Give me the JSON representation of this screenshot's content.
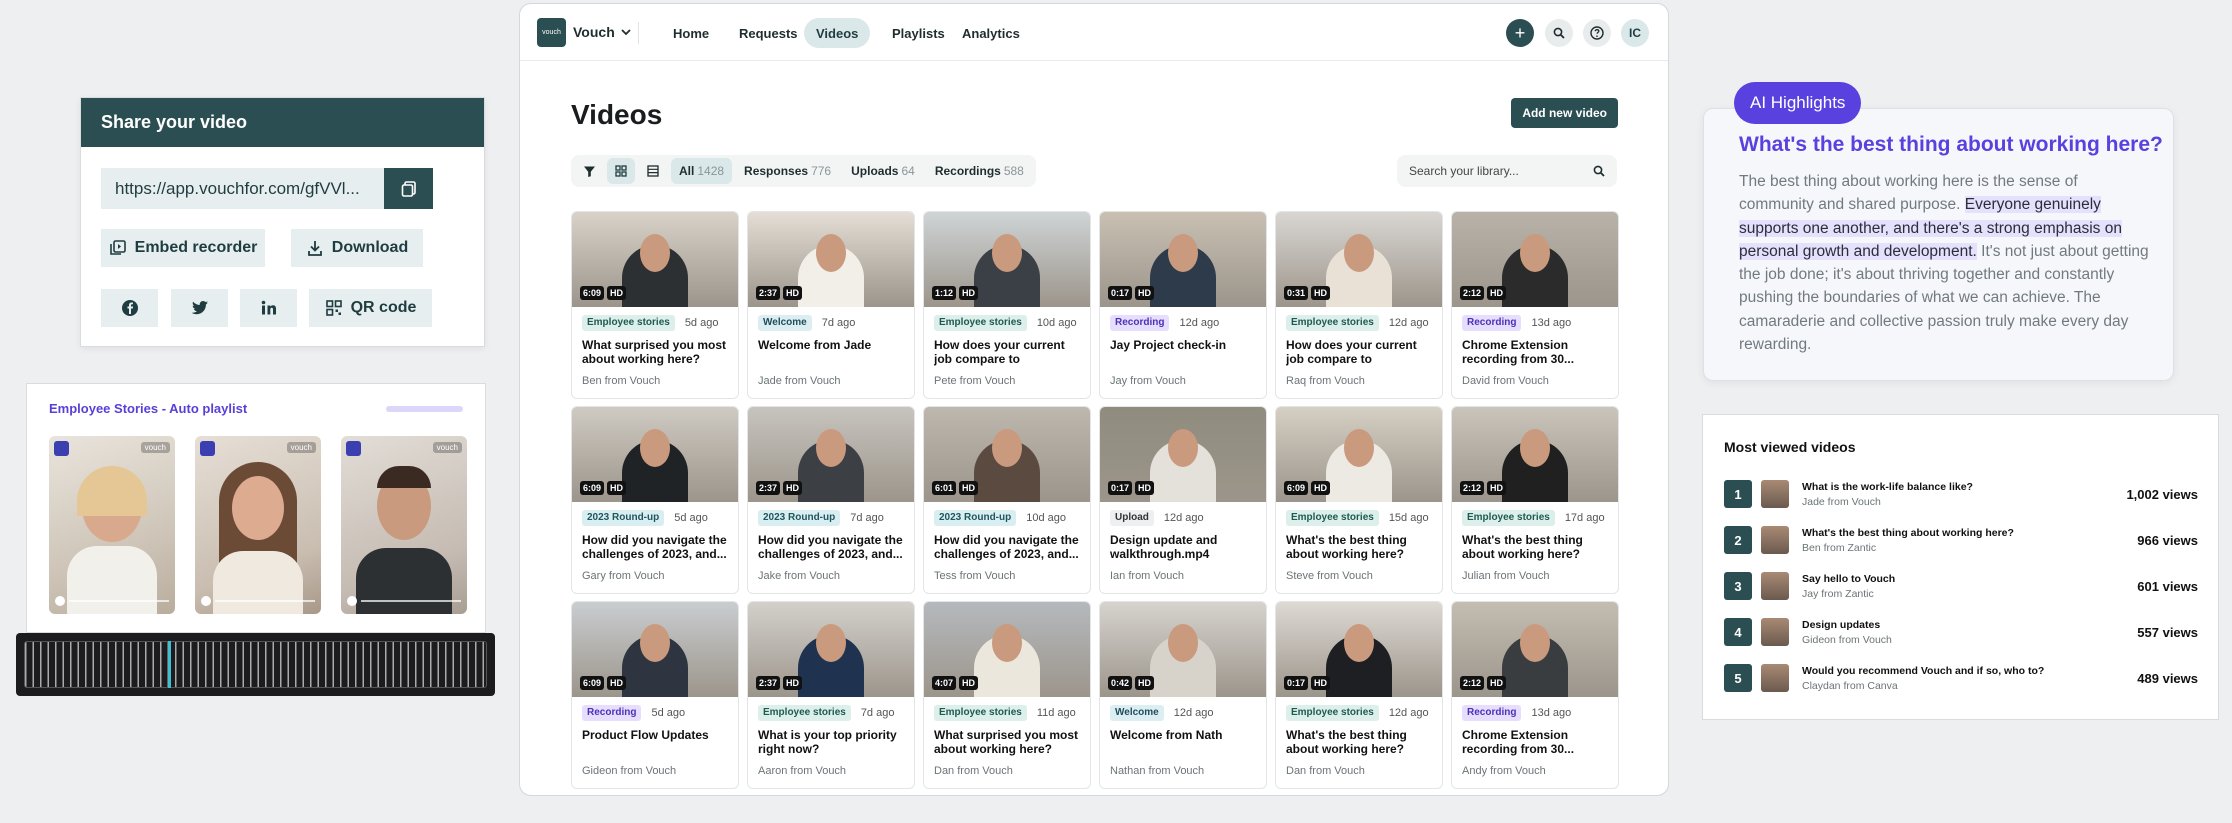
{
  "share": {
    "title": "Share your video",
    "url": "https://app.vouchfor.com/gfVVl...",
    "embed_label": "Embed recorder",
    "download_label": "Download",
    "qr_label": "QR code"
  },
  "playlist": {
    "title": "Employee Stories - Auto playlist",
    "badge": "vouch"
  },
  "app": {
    "logo": "vouch",
    "brand": "Vouch",
    "nav": [
      "Home",
      "Requests",
      "Videos",
      "Playlists",
      "Analytics"
    ],
    "avatar": "IC",
    "page_title": "Videos",
    "add_button": "Add new video",
    "filters": [
      {
        "label": "All",
        "count": "1428"
      },
      {
        "label": "Responses",
        "count": "776"
      },
      {
        "label": "Uploads",
        "count": "64"
      },
      {
        "label": "Recordings",
        "count": "588"
      }
    ],
    "search_placeholder": "Search your library...",
    "videos": [
      {
        "dur": "6:09",
        "q": "HD",
        "tag": "Employee stories",
        "ago": "5d ago",
        "title": "What surprised you most about working here?",
        "author": "Ben from Vouch"
      },
      {
        "dur": "2:37",
        "q": "HD",
        "tag": "Welcome",
        "ago": "7d ago",
        "title": "Welcome from Jade",
        "author": "Jade from Vouch"
      },
      {
        "dur": "1:12",
        "q": "HD",
        "tag": "Employee stories",
        "ago": "10d ago",
        "title": "How does your current job compare to previous...",
        "author": "Pete from Vouch"
      },
      {
        "dur": "0:17",
        "q": "HD",
        "tag": "Recording",
        "ago": "12d ago",
        "title": "Jay  Project check-in",
        "author": "Jay from Vouch"
      },
      {
        "dur": "0:31",
        "q": "HD",
        "tag": "Employee stories",
        "ago": "12d ago",
        "title": "How does your current job compare to previous...",
        "author": "Raq from Vouch"
      },
      {
        "dur": "2:12",
        "q": "HD",
        "tag": "Recording",
        "ago": "13d ago",
        "title": "Chrome Extension recording from 30...",
        "author": "David from Vouch"
      },
      {
        "dur": "6:09",
        "q": "HD",
        "tag": "2023 Round-up",
        "ago": "5d ago",
        "title": "How did you navigate the challenges of 2023, and...",
        "author": "Gary from Vouch"
      },
      {
        "dur": "2:37",
        "q": "HD",
        "tag": "2023 Round-up",
        "ago": "7d ago",
        "title": "How did you navigate the challenges of 2023, and...",
        "author": "Jake from Vouch"
      },
      {
        "dur": "6:01",
        "q": "HD",
        "tag": "2023 Round-up",
        "ago": "10d ago",
        "title": "How did you navigate the challenges of 2023, and...",
        "author": "Tess from Vouch"
      },
      {
        "dur": "0:17",
        "q": "HD",
        "tag": "Upload",
        "ago": "12d ago",
        "title": "Design update and walkthrough.mp4",
        "author": "Ian from Vouch"
      },
      {
        "dur": "6:09",
        "q": "HD",
        "tag": "Employee stories",
        "ago": "15d ago",
        "title": "What's the best thing about working here?",
        "author": "Steve from Vouch"
      },
      {
        "dur": "2:12",
        "q": "HD",
        "tag": "Employee stories",
        "ago": "17d ago",
        "title": "What's the best thing about working here?",
        "author": "Julian from Vouch"
      },
      {
        "dur": "6:09",
        "q": "HD",
        "tag": "Recording",
        "ago": "5d ago",
        "title": "Product Flow Updates",
        "author": "Gideon from Vouch"
      },
      {
        "dur": "2:37",
        "q": "HD",
        "tag": "Employee stories",
        "ago": "7d ago",
        "title": "What is your top priority right now?",
        "author": "Aaron from Vouch"
      },
      {
        "dur": "4:07",
        "q": "HD",
        "tag": "Employee stories",
        "ago": "11d ago",
        "title": "What surprised you most about working here?",
        "author": "Dan from Vouch"
      },
      {
        "dur": "0:42",
        "q": "HD",
        "tag": "Welcome",
        "ago": "12d ago",
        "title": "Welcome from Nath",
        "author": "Nathan from Vouch"
      },
      {
        "dur": "0:17",
        "q": "HD",
        "tag": "Employee stories",
        "ago": "12d ago",
        "title": "What's the best thing about working here?",
        "author": "Dan from Vouch"
      },
      {
        "dur": "2:12",
        "q": "HD",
        "tag": "Recording",
        "ago": "13d ago",
        "title": "Chrome Extension recording from 30...",
        "author": "Andy from Vouch"
      }
    ]
  },
  "ai": {
    "pill": "AI Highlights",
    "question": "What's the best thing about working here?",
    "text_before": "The best thing about working here is the sense of community and shared purpose. ",
    "text_highlight": "Everyone genuinely supports one another, and there's a strong emphasis on personal growth and development.",
    "text_after": " It's not just about getting the job done; it's about thriving together and constantly pushing the boundaries of what we can achieve. The camaraderie and collective passion truly make every day rewarding."
  },
  "most_viewed": {
    "title": "Most viewed videos",
    "items": [
      {
        "rank": "1",
        "title": "What is the work-life balance like?",
        "author": "Jade from Vouch",
        "views": "1,002 views"
      },
      {
        "rank": "2",
        "title": "What's the best thing about working here?",
        "author": "Ben from Zantic",
        "views": "966 views"
      },
      {
        "rank": "3",
        "title": "Say hello to Vouch",
        "author": "Jay from Zantic",
        "views": "601 views"
      },
      {
        "rank": "4",
        "title": "Design updates",
        "author": "Gideon from Vouch",
        "views": "557 views"
      },
      {
        "rank": "5",
        "title": "Would you recommend Vouch and if so, who to?",
        "author": "Claydan from Canva",
        "views": "489 views"
      }
    ]
  },
  "tag_colors": {
    "Employee stories": {
      "bg": "#dcefeb",
      "fg": "#1f5a50"
    },
    "Welcome": {
      "bg": "#ddeef3",
      "fg": "#1f4d5a"
    },
    "Recording": {
      "bg": "#e6defc",
      "fg": "#4b31b8"
    },
    "2023 Round-up": {
      "bg": "#d9eef0",
      "fg": "#1f5560"
    },
    "Upload": {
      "bg": "#eeeff0",
      "fg": "#333"
    }
  }
}
